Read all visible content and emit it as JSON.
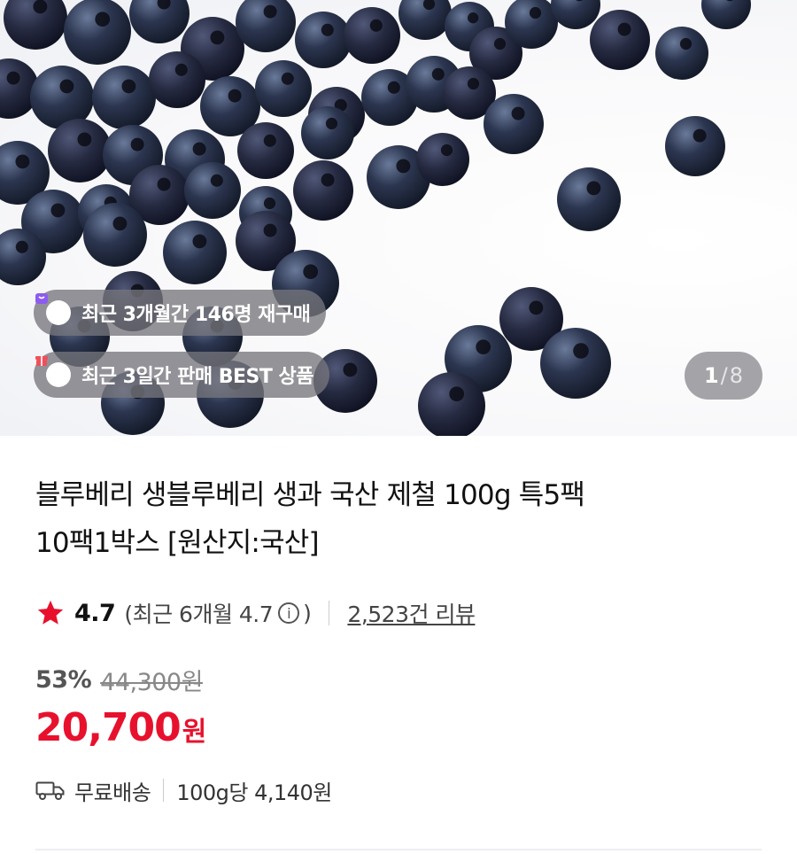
{
  "gallery": {
    "image_alt": "blueberries",
    "current": "1",
    "separator": "/",
    "total": "8"
  },
  "badges": [
    {
      "label": "최근 3개월간 146명 재구매",
      "icon": "bag-icon",
      "color": "#8e5bf0"
    },
    {
      "label": "최근 3일간 판매 BEST 상품",
      "icon": "gift-icon",
      "color": "#f0505a"
    }
  ],
  "product": {
    "title_line1": "블루베리 생블루베리 생과 국산 제철 100g 특5팩",
    "title_line2": "10팩1박스 [원산지:국산]"
  },
  "rating": {
    "value": "4.7",
    "recent_prefix": "(최근 6개월 4.7",
    "recent_suffix": ")",
    "info_glyph": "i",
    "reviews": "2,523건 리뷰",
    "star_color": "#e8112d"
  },
  "pricing": {
    "discount": "53%",
    "original": "44,300원",
    "price": "20,700",
    "currency": "원",
    "price_color": "#e8112d"
  },
  "shipping": {
    "label": "무료배송",
    "unit_price": "100g당 4,140원"
  }
}
